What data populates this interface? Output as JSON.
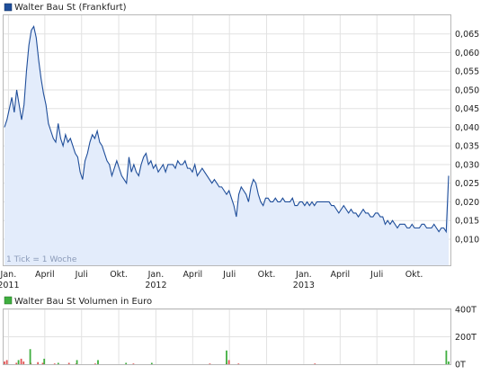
{
  "chart_data": [
    {
      "type": "area",
      "title": "Walter Bau St (Frankfurt)",
      "note": "1 Tick = 1 Woche",
      "ylim": [
        0.003,
        0.07
      ],
      "y_ticks": [
        "0,065",
        "0,060",
        "0,055",
        "0,050",
        "0,045",
        "0,040",
        "0,035",
        "0,030",
        "0,025",
        "0,020",
        "0,015",
        "0,010"
      ],
      "y_tick_values": [
        0.065,
        0.06,
        0.055,
        0.05,
        0.045,
        0.04,
        0.035,
        0.03,
        0.025,
        0.02,
        0.015,
        0.01
      ],
      "x_ticks": [
        {
          "label": "Jan.",
          "sub": "2011",
          "x": "2011-01"
        },
        {
          "label": "April",
          "sub": "",
          "x": "2011-04"
        },
        {
          "label": "Juli",
          "sub": "",
          "x": "2011-07"
        },
        {
          "label": "Okt.",
          "sub": "",
          "x": "2011-10"
        },
        {
          "label": "Jan.",
          "sub": "2012",
          "x": "2012-01"
        },
        {
          "label": "April",
          "sub": "",
          "x": "2012-04"
        },
        {
          "label": "Juli",
          "sub": "",
          "x": "2012-07"
        },
        {
          "label": "Okt.",
          "sub": "",
          "x": "2012-10"
        },
        {
          "label": "Jan.",
          "sub": "2013",
          "x": "2013-01"
        },
        {
          "label": "April",
          "sub": "",
          "x": "2013-04"
        },
        {
          "label": "Juli",
          "sub": "",
          "x": "2013-07"
        },
        {
          "label": "Okt.",
          "sub": "",
          "x": "2013-10"
        }
      ],
      "grid": true,
      "line_color": "#1f4e9a",
      "fill_color": "#e3ecfb",
      "series": [
        {
          "values": [
            0.04,
            0.042,
            0.045,
            0.048,
            0.044,
            0.05,
            0.046,
            0.042,
            0.046,
            0.055,
            0.062,
            0.066,
            0.067,
            0.064,
            0.058,
            0.053,
            0.049,
            0.046,
            0.041,
            0.039,
            0.037,
            0.036,
            0.041,
            0.037,
            0.035,
            0.038,
            0.036,
            0.037,
            0.035,
            0.033,
            0.032,
            0.028,
            0.026,
            0.031,
            0.033,
            0.036,
            0.038,
            0.037,
            0.039,
            0.036,
            0.035,
            0.033,
            0.031,
            0.03,
            0.027,
            0.029,
            0.031,
            0.029,
            0.027,
            0.026,
            0.025,
            0.032,
            0.028,
            0.03,
            0.028,
            0.027,
            0.03,
            0.032,
            0.033,
            0.03,
            0.031,
            0.029,
            0.03,
            0.028,
            0.029,
            0.03,
            0.028,
            0.03,
            0.03,
            0.03,
            0.029,
            0.031,
            0.03,
            0.03,
            0.031,
            0.029,
            0.029,
            0.028,
            0.03,
            0.027,
            0.028,
            0.029,
            0.028,
            0.027,
            0.026,
            0.025,
            0.026,
            0.025,
            0.024,
            0.024,
            0.023,
            0.022,
            0.023,
            0.021,
            0.019,
            0.016,
            0.022,
            0.024,
            0.023,
            0.022,
            0.02,
            0.024,
            0.026,
            0.025,
            0.022,
            0.02,
            0.019,
            0.021,
            0.021,
            0.02,
            0.02,
            0.021,
            0.02,
            0.02,
            0.021,
            0.02,
            0.02,
            0.02,
            0.021,
            0.019,
            0.019,
            0.02,
            0.02,
            0.019,
            0.02,
            0.019,
            0.02,
            0.019,
            0.02,
            0.02,
            0.02,
            0.02,
            0.02,
            0.02,
            0.019,
            0.019,
            0.018,
            0.017,
            0.018,
            0.019,
            0.018,
            0.017,
            0.018,
            0.017,
            0.017,
            0.016,
            0.017,
            0.018,
            0.017,
            0.017,
            0.016,
            0.016,
            0.017,
            0.017,
            0.016,
            0.016,
            0.014,
            0.015,
            0.014,
            0.015,
            0.014,
            0.013,
            0.014,
            0.014,
            0.014,
            0.013,
            0.013,
            0.014,
            0.013,
            0.013,
            0.013,
            0.014,
            0.014,
            0.013,
            0.013,
            0.013,
            0.014,
            0.013,
            0.012,
            0.013,
            0.013,
            0.012,
            0.027
          ]
        }
      ]
    },
    {
      "type": "bar",
      "title": "Walter Bau St Volumen in Euro",
      "ylim": [
        0,
        400
      ],
      "y_ticks": [
        "400T",
        "200T",
        "0T"
      ],
      "y_tick_values": [
        400,
        200,
        0
      ],
      "series": [
        {
          "color": "#e05656",
          "values": [
            20,
            30,
            0,
            0,
            0,
            10,
            0,
            40,
            20,
            0,
            0,
            10,
            0,
            0,
            15,
            0,
            10,
            0,
            0,
            0,
            0,
            5,
            0,
            0,
            0,
            0,
            0,
            10,
            0,
            0,
            5,
            0,
            0,
            0,
            0,
            0,
            0,
            0,
            5,
            0,
            0,
            0,
            0,
            0,
            0,
            0,
            0,
            0,
            0,
            0,
            0,
            0,
            0,
            0,
            5,
            0,
            0,
            0,
            0,
            0,
            0,
            0,
            0,
            0,
            0,
            0,
            0,
            0,
            0,
            0,
            0,
            0,
            0,
            0,
            0,
            0,
            0,
            0,
            0,
            0,
            0,
            0,
            0,
            0,
            0,
            0,
            5,
            0,
            0,
            0,
            0,
            0,
            0,
            10,
            30,
            0,
            0,
            0,
            5,
            0,
            0,
            0,
            0,
            0,
            0,
            0,
            0,
            0,
            0,
            0,
            0,
            0,
            0,
            0,
            0,
            0,
            0,
            0,
            0,
            0,
            0,
            0,
            0,
            0,
            0,
            0,
            0,
            0,
            0,
            0,
            5,
            0,
            0,
            0,
            0,
            0,
            0,
            0,
            0,
            0,
            0,
            0,
            0,
            0,
            0,
            0,
            0,
            0,
            0,
            0,
            0,
            0,
            0,
            0,
            0,
            0,
            0,
            0,
            0,
            0,
            0,
            0,
            0,
            0,
            0,
            0,
            0,
            0,
            0,
            0,
            0,
            0,
            0,
            0,
            0,
            0,
            0,
            0,
            0,
            0,
            0,
            0,
            0,
            0,
            0,
            0,
            0
          ]
        },
        {
          "color": "#3fae3f",
          "values": [
            0,
            0,
            0,
            0,
            0,
            0,
            30,
            0,
            0,
            0,
            0,
            110,
            0,
            0,
            0,
            0,
            0,
            40,
            0,
            0,
            0,
            0,
            0,
            10,
            0,
            0,
            0,
            0,
            0,
            0,
            0,
            30,
            0,
            0,
            0,
            0,
            0,
            0,
            0,
            0,
            30,
            0,
            0,
            0,
            0,
            0,
            0,
            0,
            0,
            0,
            0,
            0,
            10,
            0,
            0,
            0,
            0,
            0,
            0,
            0,
            0,
            0,
            0,
            10,
            0,
            0,
            0,
            0,
            0,
            0,
            0,
            0,
            0,
            0,
            0,
            0,
            0,
            0,
            0,
            0,
            0,
            0,
            0,
            0,
            0,
            0,
            0,
            0,
            0,
            0,
            0,
            0,
            0,
            0,
            0,
            100,
            0,
            0,
            0,
            0,
            0,
            0,
            0,
            0,
            0,
            0,
            0,
            0,
            0,
            0,
            0,
            0,
            0,
            0,
            0,
            0,
            0,
            0,
            0,
            0,
            0,
            0,
            0,
            0,
            0,
            0,
            0,
            0,
            0,
            0,
            0,
            0,
            0,
            0,
            0,
            0,
            0,
            0,
            0,
            0,
            0,
            0,
            0,
            0,
            0,
            0,
            0,
            0,
            0,
            0,
            0,
            0,
            0,
            0,
            0,
            0,
            0,
            0,
            0,
            0,
            0,
            0,
            0,
            0,
            0,
            0,
            0,
            0,
            0,
            0,
            0,
            0,
            0,
            0,
            0,
            0,
            0,
            0,
            0,
            0,
            0,
            0,
            0,
            0,
            0,
            0,
            0,
            0,
            0,
            100,
            20
          ]
        }
      ]
    }
  ]
}
